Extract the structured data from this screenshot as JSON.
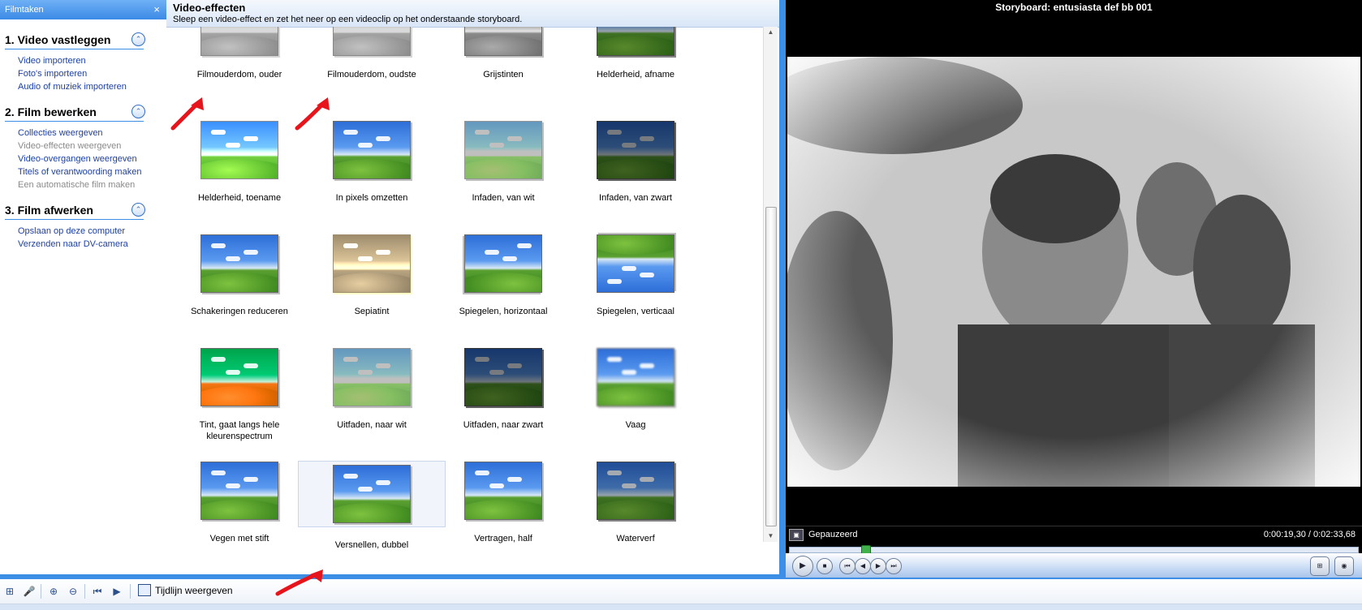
{
  "taskpane": {
    "header": "Filmtaken",
    "close": "×",
    "sections": [
      {
        "title": "1. Video vastleggen",
        "links": [
          {
            "label": "Video importeren",
            "enabled": true
          },
          {
            "label": "Foto's importeren",
            "enabled": true
          },
          {
            "label": "Audio of muziek importeren",
            "enabled": true
          }
        ]
      },
      {
        "title": "2. Film bewerken",
        "links": [
          {
            "label": "Collecties weergeven",
            "enabled": true
          },
          {
            "label": "Video-effecten weergeven",
            "enabled": false
          },
          {
            "label": "Video-overgangen weergeven",
            "enabled": true
          },
          {
            "label": "Titels of verantwoording maken",
            "enabled": true
          },
          {
            "label": "Een automatische film maken",
            "enabled": false
          }
        ]
      },
      {
        "title": "3. Film afwerken",
        "links": [
          {
            "label": "Opslaan op deze computer",
            "enabled": true
          },
          {
            "label": "Verzenden naar DV-camera",
            "enabled": true
          }
        ]
      }
    ]
  },
  "content": {
    "title": "Video-effecten",
    "subtitle": "Sleep een video-effect en zet het neer op een videoclip op het onderstaande storyboard.",
    "effects": [
      {
        "label": "Filmouderdom, ouder",
        "style": "old"
      },
      {
        "label": "Filmouderdom, oudste",
        "style": "old"
      },
      {
        "label": "Grijstinten",
        "style": "gray"
      },
      {
        "label": "Helderheid, afname",
        "style": "dark"
      },
      {
        "label": "Helderheid, toename",
        "style": "bright"
      },
      {
        "label": "In pixels omzetten",
        "style": "normal"
      },
      {
        "label": "Infaden, van wit",
        "style": "fadewhite"
      },
      {
        "label": "Infaden, van zwart",
        "style": "fadeblack"
      },
      {
        "label": "Schakeringen reduceren",
        "style": "normal"
      },
      {
        "label": "Sepiatint",
        "style": "sepia"
      },
      {
        "label": "Spiegelen, horizontaal",
        "style": "fliph"
      },
      {
        "label": "Spiegelen, verticaal",
        "style": "flipv"
      },
      {
        "label": "Tint, gaat langs hele kleurenspectrum",
        "style": "pink"
      },
      {
        "label": "Uitfaden, naar wit",
        "style": "fadewhite"
      },
      {
        "label": "Uitfaden, naar zwart",
        "style": "fadeblack"
      },
      {
        "label": "Vaag",
        "style": "blur"
      },
      {
        "label": "Vegen met stift",
        "style": "normal"
      },
      {
        "label": "Versnellen, dubbel",
        "style": "normal",
        "selected": true
      },
      {
        "label": "Vertragen, half",
        "style": "normal"
      },
      {
        "label": "Waterverf",
        "style": "dark"
      }
    ]
  },
  "monitor": {
    "title": "Storyboard: entusiasta def bb 001",
    "status": "Gepauzeerd",
    "time": "0:00:19,30 / 0:02:33,68",
    "progress_fraction": 0.126
  },
  "toolbar": {
    "timeline_label": "Tijdlijn weergeven"
  },
  "colors": {
    "accent": "#3d8fe6",
    "link": "#1c3fa8",
    "annotation": "#e8141c"
  }
}
